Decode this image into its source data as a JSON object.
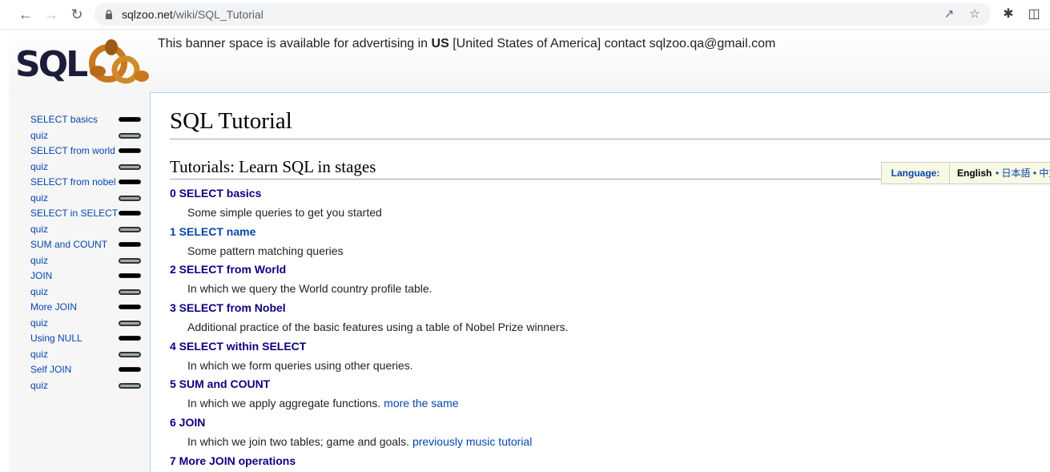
{
  "browser": {
    "url_domain": "sqlzoo.net",
    "url_path": "/wiki/SQL_Tutorial",
    "icons": [
      "back-icon",
      "forward-icon",
      "reload-icon",
      "lock-icon",
      "share-icon",
      "star-icon",
      "extensions-icon",
      "sidepanel-icon"
    ]
  },
  "header": {
    "logo_text": "SQLZOO",
    "banner_pre": "This banner space is available for advertising in ",
    "banner_bold": "US",
    "banner_post": " [United States of America] contact sqlzoo.qa@gmail.com"
  },
  "sidebar": {
    "items": [
      {
        "label": "SELECT basics",
        "pill": "filled"
      },
      {
        "label": "quiz",
        "pill": "hollow"
      },
      {
        "label": "SELECT from world",
        "pill": "filled"
      },
      {
        "label": "quiz",
        "pill": "hollow"
      },
      {
        "label": "SELECT from nobel",
        "pill": "filled"
      },
      {
        "label": "quiz",
        "pill": "hollow"
      },
      {
        "label": "SELECT in SELECT",
        "pill": "filled"
      },
      {
        "label": "quiz",
        "pill": "hollow"
      },
      {
        "label": "SUM and COUNT",
        "pill": "filled"
      },
      {
        "label": "quiz",
        "pill": "hollow"
      },
      {
        "label": "JOIN",
        "pill": "filled"
      },
      {
        "label": "quiz",
        "pill": "hollow"
      },
      {
        "label": "More JOIN",
        "pill": "filled"
      },
      {
        "label": "quiz",
        "pill": "hollow"
      },
      {
        "label": "Using NULL",
        "pill": "filled"
      },
      {
        "label": "quiz",
        "pill": "hollow"
      },
      {
        "label": "Self JOIN",
        "pill": "filled"
      },
      {
        "label": "quiz",
        "pill": "hollow"
      }
    ]
  },
  "main": {
    "title": "SQL Tutorial",
    "subtitle": "Tutorials: Learn SQL in stages",
    "language": {
      "label": "Language:",
      "current": "English",
      "others": "• 日本語 • 中文"
    },
    "tutorials": [
      {
        "title": "0 SELECT basics",
        "desc": "Some simple queries to get you started",
        "link": ""
      },
      {
        "title": "1 SELECT name",
        "desc": "Some pattern matching queries",
        "link": ""
      },
      {
        "title": "2 SELECT from World",
        "desc": "In which we query the World country profile table.",
        "link": ""
      },
      {
        "title": "3 SELECT from Nobel",
        "desc": "Additional practice of the basic features using a table of Nobel Prize winners.",
        "link": ""
      },
      {
        "title": "4 SELECT within SELECT",
        "desc": "In which we form queries using other queries.",
        "link": ""
      },
      {
        "title": "5 SUM and COUNT",
        "desc": "In which we apply aggregate functions. ",
        "link": "more the same"
      },
      {
        "title": "6 JOIN",
        "desc": "In which we join two tables; game and goals. ",
        "link": "previously music tutorial"
      },
      {
        "title": "7 More JOIN operations",
        "desc": "",
        "link": ""
      }
    ]
  },
  "colors": {
    "link": "#0645ad",
    "visited": "#0b0080",
    "border": "#a7d7f9"
  }
}
